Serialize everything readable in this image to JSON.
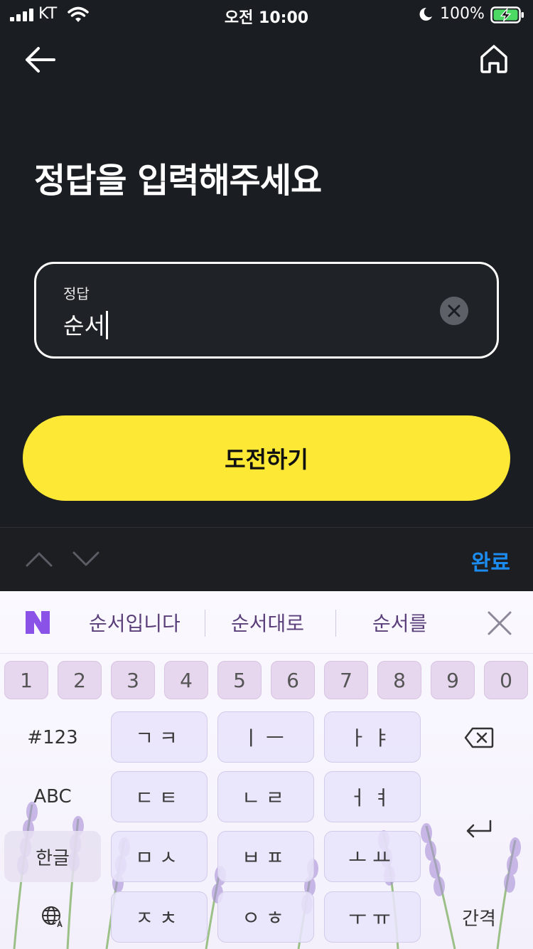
{
  "status": {
    "carrier": "KT",
    "time": "오전 10:00",
    "battery": "100%"
  },
  "title": "정답을 입력해주세요",
  "answer_field": {
    "label": "정답",
    "value": "순서"
  },
  "submit_label": "도전하기",
  "accessory": {
    "done_label": "완료"
  },
  "keyboard": {
    "suggestions": [
      "순서입니다",
      "순서대로",
      "순서를"
    ],
    "numbers": [
      "1",
      "2",
      "3",
      "4",
      "5",
      "6",
      "7",
      "8",
      "9",
      "0"
    ],
    "rows": [
      {
        "side_left": "#123",
        "keys": [
          "ㄱㅋ",
          "ㅣㅡ",
          "ㅏㅑ"
        ]
      },
      {
        "side_left": "ABC",
        "keys": [
          "ㄷㅌ",
          "ㄴㄹ",
          "ㅓㅕ"
        ]
      },
      {
        "side_left": "한글",
        "keys": [
          "ㅁㅅ",
          "ㅂㅍ",
          "ㅗㅛ"
        ]
      },
      {
        "keys": [
          "ㅈㅊ",
          "ㅇㅎ",
          "ㅜㅠ"
        ],
        "side_right": "간격"
      }
    ]
  },
  "colors": {
    "accent": "#fde935",
    "done": "#1c8cf0",
    "background": "#1a1d21"
  }
}
